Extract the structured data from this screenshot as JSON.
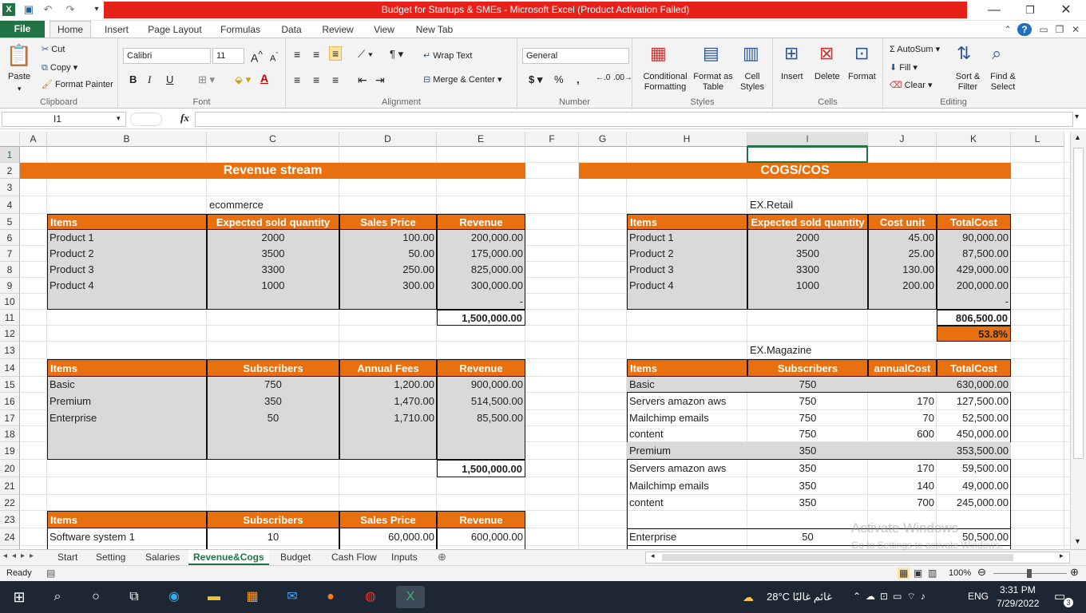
{
  "window": {
    "title": "Budget for Startups & SMEs  -  Microsoft Excel (Product Activation Failed)"
  },
  "tabs": [
    "File",
    "Home",
    "Insert",
    "Page Layout",
    "Formulas",
    "Data",
    "Review",
    "View",
    "New Tab"
  ],
  "ribbon": {
    "clipboard": {
      "label": "Clipboard",
      "paste": "Paste",
      "cut": "Cut",
      "copy": "Copy",
      "format_painter": "Format Painter"
    },
    "font": {
      "label": "Font",
      "name": "Calibri",
      "size": "11",
      "bold": "B",
      "italic": "I",
      "underline": "U"
    },
    "alignment": {
      "label": "Alignment",
      "wrap": "Wrap Text",
      "merge": "Merge & Center"
    },
    "number": {
      "label": "Number",
      "format": "General",
      "currency": "$",
      "percent": "%",
      "comma": ","
    },
    "styles": {
      "label": "Styles",
      "conditional": "Conditional Formatting",
      "format_table": "Format as Table",
      "cell_styles": "Cell Styles"
    },
    "cells": {
      "label": "Cells",
      "insert": "Insert",
      "delete": "Delete",
      "format": "Format"
    },
    "editing": {
      "label": "Editing",
      "autosum": "AutoSum",
      "fill": "Fill",
      "clear": "Clear",
      "sort": "Sort & Filter",
      "find": "Find & Select"
    }
  },
  "formula_bar": {
    "namebox": "I1",
    "fx": "fx",
    "value": ""
  },
  "columns": [
    "A",
    "B",
    "C",
    "D",
    "E",
    "F",
    "G",
    "H",
    "I",
    "J",
    "K",
    "L"
  ],
  "rows": [
    "1",
    "2",
    "3",
    "4",
    "5",
    "6",
    "7",
    "8",
    "9",
    "10",
    "11",
    "12",
    "13",
    "14",
    "15",
    "16",
    "17",
    "18",
    "19",
    "20",
    "21",
    "22",
    "23",
    "24",
    "25"
  ],
  "sheet": {
    "revenue_title": "Revenue stream",
    "cogs_title": "COGS/COS",
    "ecommerce_label": "ecommerce",
    "retail_label": "EX.Retail",
    "magazine_label": "EX.Magazine",
    "t1_headers": [
      "Items",
      "Expected sold quantity",
      "Sales Price",
      "Revenue"
    ],
    "t1_rows": [
      [
        "Product 1",
        "2000",
        "100.00",
        "200,000.00"
      ],
      [
        "Product 2",
        "3500",
        "50.00",
        "175,000.00"
      ],
      [
        "Product 3",
        "3300",
        "250.00",
        "825,000.00"
      ],
      [
        "Product 4",
        "1000",
        "300.00",
        "300,000.00"
      ],
      [
        "",
        "",
        "",
        "-"
      ]
    ],
    "t1_total": "1,500,000.00",
    "t2_headers": [
      "Items",
      "Subscribers",
      "Annual Fees",
      "Revenue"
    ],
    "t2_rows": [
      [
        "Basic",
        "750",
        "1,200.00",
        "900,000.00"
      ],
      [
        "Premium",
        "350",
        "1,470.00",
        "514,500.00"
      ],
      [
        "Enterprise",
        "50",
        "1,710.00",
        "85,500.00"
      ]
    ],
    "t2_total": "1,500,000.00",
    "t3_headers": [
      "Items",
      "Subscribers",
      "Sales Price",
      "Revenue"
    ],
    "t3_rows": [
      [
        "Software system 1",
        "10",
        "60,000.00",
        "600,000.00"
      ]
    ],
    "r1_headers": [
      "Items",
      "Expected sold quantity",
      "Cost unit",
      "TotalCost"
    ],
    "r1_rows": [
      [
        "Product 1",
        "2000",
        "45.00",
        "90,000.00"
      ],
      [
        "Product 2",
        "3500",
        "25.00",
        "87,500.00"
      ],
      [
        "Product 3",
        "3300",
        "130.00",
        "429,000.00"
      ],
      [
        "Product 4",
        "1000",
        "200.00",
        "200,000.00"
      ],
      [
        "",
        "",
        "",
        "-"
      ]
    ],
    "r1_total": "806,500.00",
    "r1_pct": "53.8%",
    "r2_headers": [
      "Items",
      "Subscribers",
      "annualCost",
      "TotalCost"
    ],
    "r2_rows": [
      [
        "Basic",
        "750",
        "",
        "630,000.00"
      ],
      [
        "Servers amazon aws",
        "750",
        "170",
        "127,500.00"
      ],
      [
        "Mailchimp emails",
        "750",
        "70",
        "52,500.00"
      ],
      [
        "content",
        "750",
        "600",
        "450,000.00"
      ],
      [
        "Premium",
        "350",
        "",
        "353,500.00"
      ],
      [
        "Servers amazon aws",
        "350",
        "170",
        "59,500.00"
      ],
      [
        "Mailchimp emails",
        "350",
        "140",
        "49,000.00"
      ],
      [
        "content",
        "350",
        "700",
        "245,000.00"
      ],
      [
        "",
        "",
        "",
        ""
      ],
      [
        "Enterprise",
        "50",
        "",
        "50,500.00"
      ]
    ]
  },
  "sheet_tabs": [
    "Start",
    "Setting",
    "Salaries",
    "Revenue&Cogs",
    "Budget",
    "Cash Flow",
    "Inputs"
  ],
  "active_sheet": "Revenue&Cogs",
  "status": {
    "ready": "Ready",
    "zoom": "100%"
  },
  "watermark": {
    "line1": "Activate Windows",
    "line2": "Go to Settings to activate Windows."
  },
  "taskbar": {
    "weather": "28°C  غائم غالبًا",
    "lang": "ENG",
    "time": "3:31 PM",
    "date": "7/29/2022",
    "notif": "3"
  }
}
